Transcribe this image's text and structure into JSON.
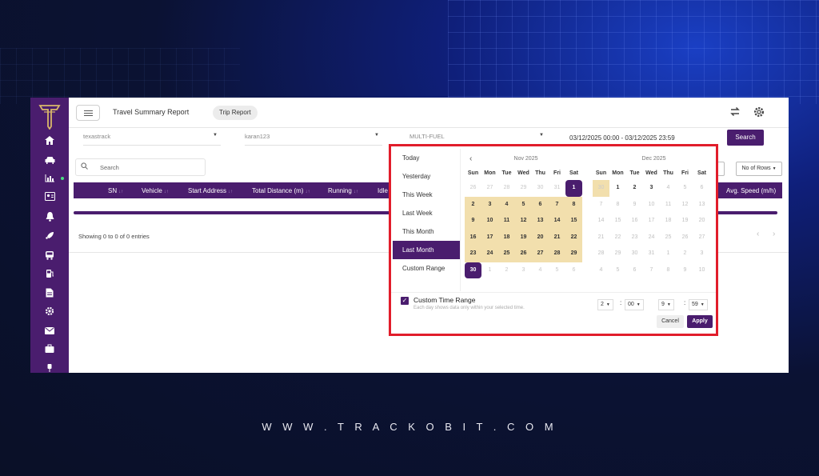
{
  "page": {
    "title": "Travel Summary Report",
    "report_tab": "Trip Report"
  },
  "filters": {
    "company": "texastrack",
    "user": "karan123",
    "fuel_type": "MULTI-FUEL",
    "date_range": "03/12/2025 00:00 - 03/12/2025 23:59",
    "search_button": "Search"
  },
  "table": {
    "search_placeholder": "Search",
    "rows_label": "No of Rows",
    "columns": [
      "SN",
      "Vehicle",
      "Start Address",
      "Total Distance (m)",
      "Running",
      "Idle",
      "Avg. Speed (m/h)"
    ],
    "info": "Showing 0 to 0 of 0 entries"
  },
  "picker": {
    "ranges": [
      "Today",
      "Yesterday",
      "This Week",
      "Last Week",
      "This Month",
      "Last Month",
      "Custom Range"
    ],
    "active_range": "Last Month",
    "weekdays": [
      "Sun",
      "Mon",
      "Tue",
      "Wed",
      "Thu",
      "Fri",
      "Sat"
    ],
    "left_month": "Nov 2025",
    "right_month": "Dec 2025",
    "custom_label": "Custom Time Range",
    "custom_hint": "Each day shows data only within your selected time.",
    "from_hour": "2",
    "from_min": "00",
    "to_hour": "9",
    "to_min": "59",
    "cancel": "Cancel",
    "apply": "Apply"
  },
  "footer": {
    "website": "W W W . T R A C K O B I T . C O M"
  },
  "colors": {
    "brand": "#4a1d6e",
    "range_fill": "#f2dfad",
    "highlight": "#e11d2b"
  }
}
